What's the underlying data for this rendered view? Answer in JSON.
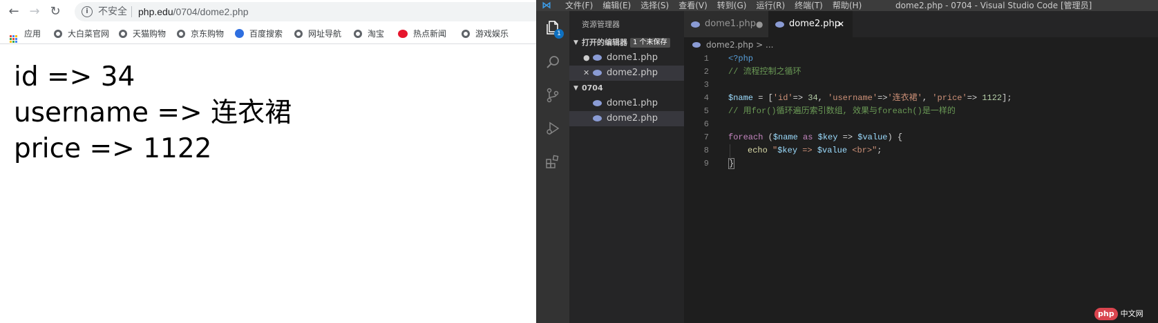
{
  "browser": {
    "insecure_label": "不安全",
    "url_host": "php.edu",
    "url_path": "/0704/dome2.php",
    "bookmarks": {
      "apps": "应用",
      "items": [
        "大白菜官网",
        "天猫购物",
        "京东购物",
        "百度搜索",
        "网址导航",
        "淘宝",
        "热点新闻",
        "游戏娱乐"
      ]
    },
    "output": [
      "id => 34",
      "username => 连衣裙",
      "price => 1122"
    ]
  },
  "vscode": {
    "menu": [
      "文件(F)",
      "编辑(E)",
      "选择(S)",
      "查看(V)",
      "转到(G)",
      "运行(R)",
      "终端(T)",
      "帮助(H)"
    ],
    "window_title": "dome2.php - 0704 - Visual Studio Code [管理员]",
    "badge": "1",
    "sidebar": {
      "title": "资源管理器",
      "open_editors_label": "打开的编辑器",
      "unsaved_label": "1 个未保存",
      "open_editors": [
        "dome1.php",
        "dome2.php"
      ],
      "folder_label": "0704",
      "folder_files": [
        "dome1.php",
        "dome2.php"
      ]
    },
    "tabs": [
      "dome1.php",
      "dome2.php"
    ],
    "breadcrumb": "dome2.php > ...",
    "line_numbers": [
      "1",
      "2",
      "3",
      "4",
      "5",
      "6",
      "7",
      "8",
      "9"
    ],
    "code": {
      "l1": "<?php",
      "l2": "// 流程控制之循环",
      "l4_var": "$name",
      "l4_eq": " = [",
      "l4_k1": "'id'",
      "l4_arrow1": "=> ",
      "l4_v1": "34",
      "l4_c1": ", ",
      "l4_k2": "'username'",
      "l4_arrow2": "=>",
      "l4_v2": "'连衣裙'",
      "l4_c2": ", ",
      "l4_k3": "'price'",
      "l4_arrow3": "=> ",
      "l4_v3": "1122",
      "l4_end": "];",
      "l5": "// 用for()循环遍历索引数组, 效果与foreach()是一样的",
      "l7_kw": "foreach",
      "l7_p1": " (",
      "l7_var1": "$name",
      "l7_as": " as ",
      "l7_var2": "$key",
      "l7_arrow": " => ",
      "l7_var3": "$value",
      "l7_end": ") {",
      "l8_echo": "echo ",
      "l8_q1": "\"",
      "l8_var1": "$key",
      "l8_mid": " => ",
      "l8_var2": "$value",
      "l8_tail": " <br>\"",
      "l8_end": ";",
      "l9": "}"
    },
    "watermark": {
      "pill": "php",
      "text": "中文网"
    }
  }
}
